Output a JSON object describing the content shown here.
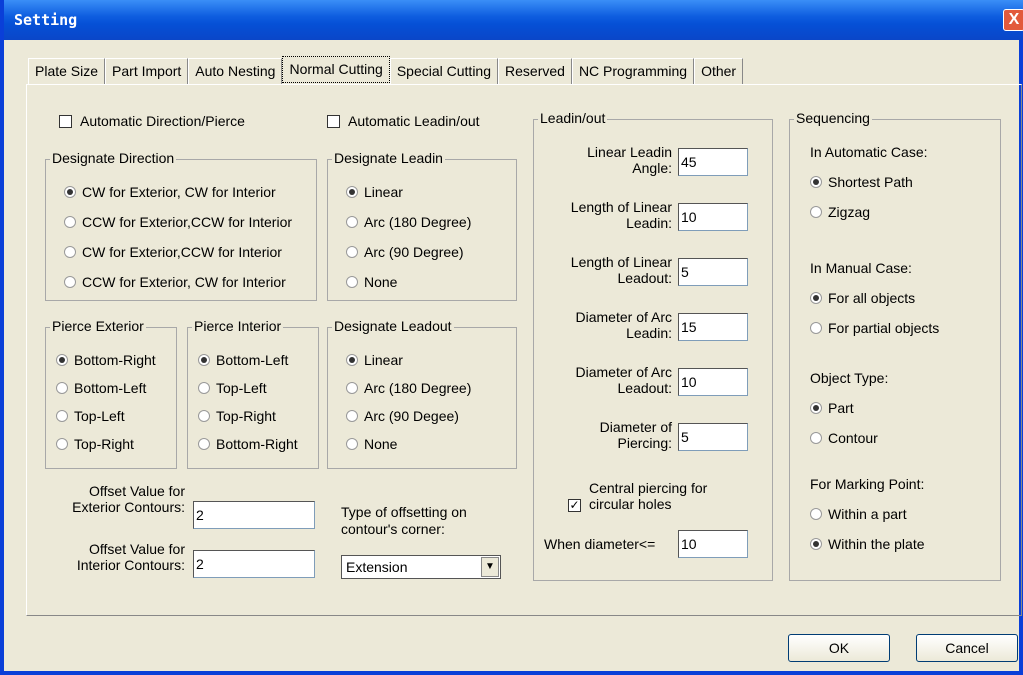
{
  "window": {
    "title": "Setting",
    "close_label": "X"
  },
  "tabs": [
    "Plate Size",
    "Part Import",
    "Auto Nesting",
    "Normal Cutting",
    "Special Cutting",
    "Reserved",
    "NC Programming",
    "Other"
  ],
  "auto_dir": {
    "label": "Automatic Direction/Pierce",
    "checked": false
  },
  "auto_leadin": {
    "label": "Automatic Leadin/out",
    "checked": false
  },
  "designate_direction": {
    "title": "Designate Direction",
    "options": [
      "CW for Exterior, CW for Interior",
      "CCW for Exterior,CCW for Interior",
      "CW for Exterior,CCW for Interior",
      "CCW for Exterior, CW for Interior"
    ],
    "selected": 0
  },
  "designate_leadin": {
    "title": "Designate Leadin",
    "options": [
      "Linear",
      "Arc (180 Degree)",
      "Arc (90 Degree)",
      "None"
    ],
    "selected": 0
  },
  "pierce_exterior": {
    "title": "Pierce Exterior",
    "options": [
      "Bottom-Right",
      "Bottom-Left",
      "Top-Left",
      "Top-Right"
    ],
    "selected": 0
  },
  "pierce_interior": {
    "title": "Pierce Interior",
    "options": [
      "Bottom-Left",
      "Top-Left",
      "Top-Right",
      "Bottom-Right"
    ],
    "selected": 0
  },
  "designate_leadout": {
    "title": "Designate Leadout",
    "options": [
      "Linear",
      "Arc (180 Degree)",
      "Arc (90 Degee)",
      "None"
    ],
    "selected": 0
  },
  "offset": {
    "ext_label1": "Offset Value for",
    "ext_label2": "Exterior Contours:",
    "ext_value": "2",
    "int_label1": "Offset Value for",
    "int_label2": "Interior Contours:",
    "int_value": "2",
    "type_label1": "Type of offsetting on",
    "type_label2": "contour's corner:",
    "type_value": "Extension"
  },
  "leadin_out": {
    "title": "Leadin/out",
    "fields": [
      {
        "l1": "Linear  Leadin",
        "l2": "Angle:",
        "value": "45"
      },
      {
        "l1": "Length of Linear",
        "l2": "Leadin:",
        "value": "10"
      },
      {
        "l1": "Length of Linear",
        "l2": "Leadout:",
        "value": "5"
      },
      {
        "l1": "Diameter of Arc",
        "l2": "Leadin:",
        "value": "15"
      },
      {
        "l1": "Diameter of Arc",
        "l2": "Leadout:",
        "value": "10"
      },
      {
        "l1": "Diameter of",
        "l2": "Piercing:",
        "value": "5"
      }
    ],
    "central_l1": "Central piercing for",
    "central_l2": "circular holes",
    "central_checked": true,
    "when_label": "When diameter<=",
    "when_value": "10"
  },
  "sequencing": {
    "title": "Sequencing",
    "auto_label": "In Automatic Case:",
    "auto_options": [
      "Shortest Path",
      "Zigzag"
    ],
    "auto_selected": 0,
    "manual_label": "In Manual Case:",
    "manual_options": [
      "For all objects",
      "For partial objects"
    ],
    "manual_selected": 0,
    "object_label": "Object Type:",
    "object_options": [
      "Part",
      "Contour"
    ],
    "object_selected": 0,
    "marking_label": "For Marking Point:",
    "marking_options": [
      "Within a part",
      "Within the plate"
    ],
    "marking_selected": 1
  },
  "buttons": {
    "ok": "OK",
    "cancel": "Cancel"
  }
}
